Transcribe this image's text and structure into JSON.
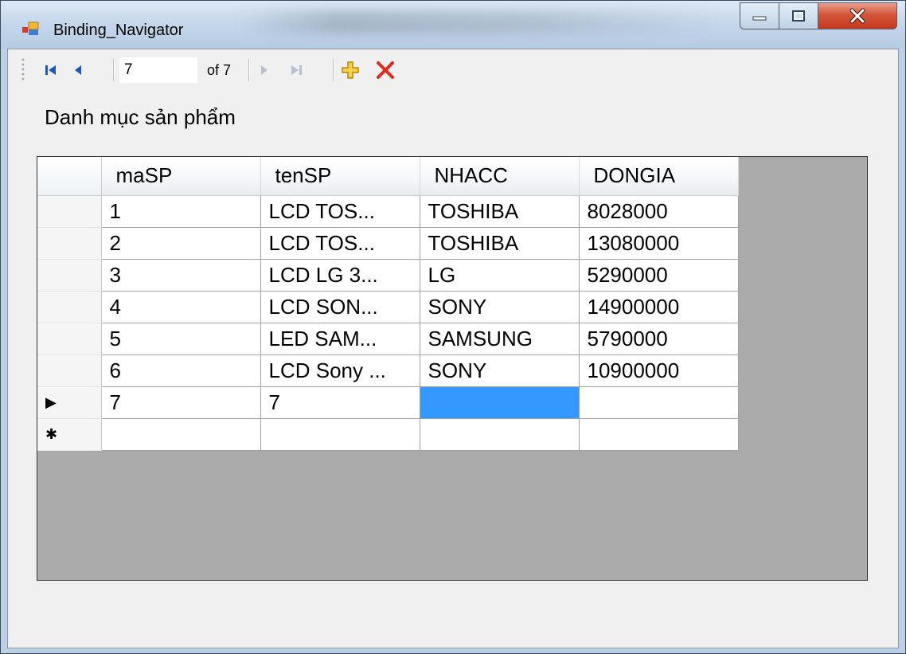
{
  "window": {
    "title": "Binding_Navigator",
    "icon": "form-icon"
  },
  "navigator": {
    "position_value": "7",
    "count_label": "of 7",
    "buttons": [
      "move-first-icon",
      "move-previous-icon",
      "move-next-icon",
      "move-last-icon",
      "add-new-icon",
      "delete-icon"
    ]
  },
  "main": {
    "heading": "Danh mục sản phẩm"
  },
  "grid": {
    "columns": [
      "maSP",
      "tenSP",
      "NHACC",
      "DONGIA"
    ],
    "rows": [
      {
        "indicator": "",
        "cells": [
          "1",
          "LCD TOS...",
          "TOSHIBA",
          "8028000"
        ]
      },
      {
        "indicator": "",
        "cells": [
          "2",
          "LCD TOS...",
          "TOSHIBA",
          "13080000"
        ]
      },
      {
        "indicator": "",
        "cells": [
          "3",
          "LCD LG 3...",
          "LG",
          "5290000"
        ]
      },
      {
        "indicator": "",
        "cells": [
          "4",
          "LCD SON...",
          "SONY",
          "14900000"
        ]
      },
      {
        "indicator": "",
        "cells": [
          "5",
          "LED SAM...",
          "SAMSUNG",
          "5790000"
        ]
      },
      {
        "indicator": "",
        "cells": [
          "6",
          "LCD Sony ...",
          "SONY",
          "10900000"
        ]
      },
      {
        "indicator": "▶",
        "cells": [
          "7",
          "7",
          "",
          ""
        ]
      },
      {
        "indicator": "✱",
        "cells": [
          "",
          "",
          "",
          ""
        ]
      }
    ],
    "selected_color": "#3399ff"
  }
}
